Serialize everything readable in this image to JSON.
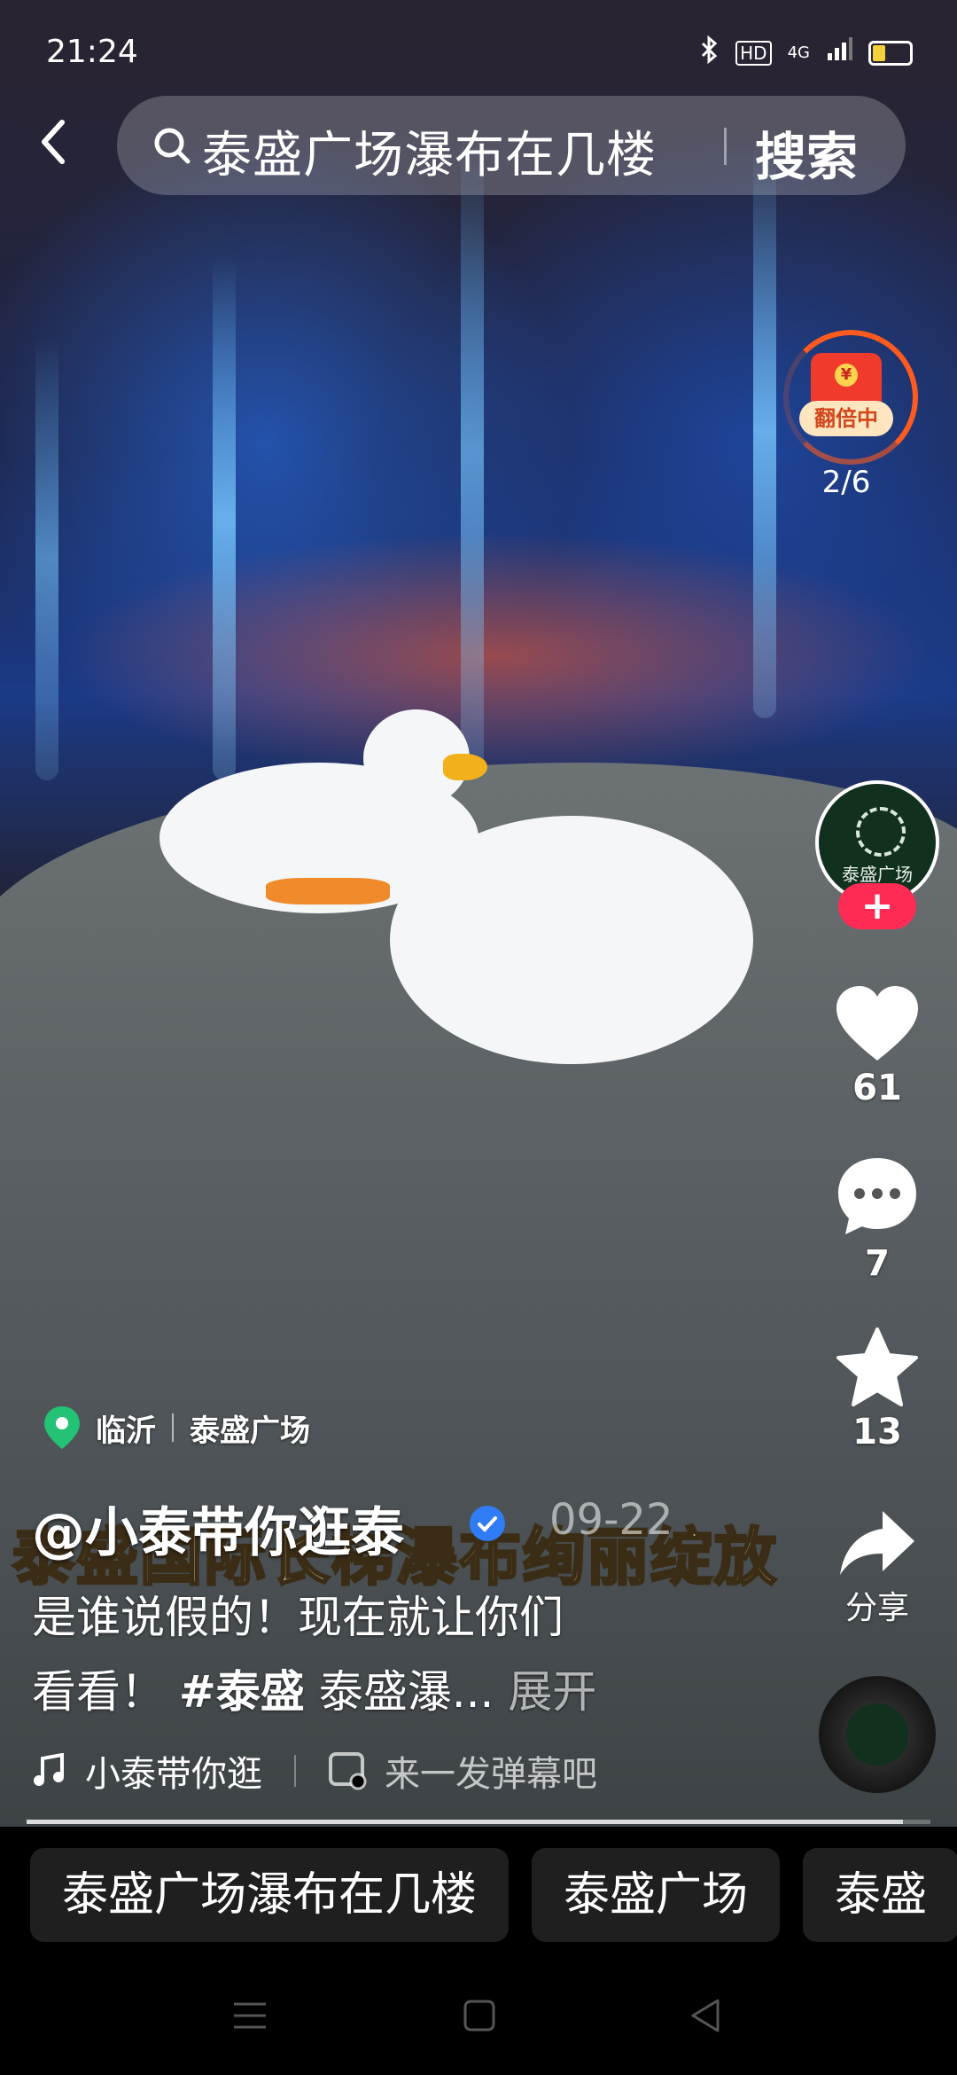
{
  "status_bar": {
    "time": "21:24",
    "hd": "HD",
    "network": "4G"
  },
  "search": {
    "query": "泰盛广场瀑布在几楼",
    "button_label": "搜索"
  },
  "red_packet": {
    "label": "翻倍中",
    "count": "2/6"
  },
  "account": {
    "avatar_text": "泰盛广场",
    "follow": "+"
  },
  "actions": {
    "likes": "61",
    "comments": "7",
    "favorites": "13",
    "share_label": "分享"
  },
  "location": {
    "city": "临沂",
    "place": "泰盛广场"
  },
  "video": {
    "subtitle": "泰盛国际长梯瀑布绚丽绽放",
    "author": "@小泰带你逛泰",
    "date": "09-22",
    "desc_line1": "是谁说假的！现在就让你们",
    "desc_line2_start": "看看！",
    "hashtag": "#泰盛",
    "desc_line2_end": "泰盛瀑...",
    "more_label": "展开",
    "music": "小泰带你逛",
    "danmu_placeholder": "来一发弹幕吧",
    "progress": 0.97
  },
  "suggestions": [
    "泰盛广场瀑布在几楼",
    "泰盛广场",
    "泰盛"
  ]
}
